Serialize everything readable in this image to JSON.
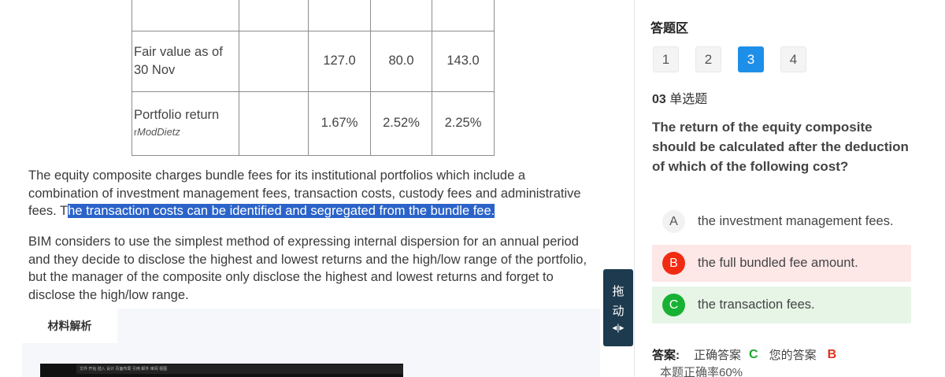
{
  "table": {
    "rows": [
      {
        "label": "Fair value as of 30 Nov",
        "sub": "",
        "values": [
          "127.0",
          "80.0",
          "143.0"
        ]
      },
      {
        "label": "Portfolio return",
        "sub_prefix": "r",
        "sub": "ModDietz",
        "values": [
          "1.67%",
          "2.52%",
          "2.25%"
        ]
      }
    ]
  },
  "material": {
    "p1_before": "The equity composite charges bundle fees for its institutional portfolios which include a combination of investment management fees, transaction costs, custody fees and administrative fees. T",
    "p1_highlight": "he transaction costs can be identified and segregated from the bundle fee.",
    "p2": "BIM considers to use the simplest method of expressing internal dispersion for an annual period and they decide to disclose the highest and lowest returns and the high/low range of the portfolio, but the manager of the composite only disclose the highest and lowest returns and forget to disclose the high/low range.",
    "tab_label": "材料解析",
    "thumb_text": "文件 开始 插入 设计 页面布局 引用 邮件 审阅 视图"
  },
  "drag": {
    "label_1": "拖",
    "label_2": "动",
    "icon": "drag-handle-icon"
  },
  "answer_area": {
    "title": "答题区",
    "question_numbers": [
      "1",
      "2",
      "3",
      "4"
    ],
    "active_index": 2,
    "question_no": "03",
    "question_type": "单选题",
    "question_text": "The return of the equity composite should be calculated after the deduction of which of the following cost?",
    "options": [
      {
        "letter": "A",
        "text": "the investment management fees."
      },
      {
        "letter": "B",
        "text": "the full bundled fee amount."
      },
      {
        "letter": "C",
        "text": "the transaction fees."
      }
    ],
    "answer_label": "答案:",
    "correct_label": "正确答案",
    "correct_value": "C",
    "your_label": "您的答案",
    "your_value": "B",
    "accuracy": "本题正确率60%"
  },
  "colors": {
    "active": "#1e8fe8",
    "wrong": "#f02b12",
    "correct": "#17b233",
    "highlight": "#2b63c9"
  }
}
